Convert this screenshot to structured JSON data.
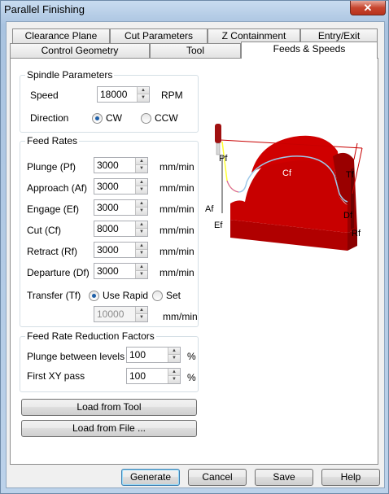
{
  "window": {
    "title": "Parallel Finishing",
    "close_glyph": "✕"
  },
  "tabs": {
    "back_row": [
      "Clearance Plane",
      "Cut Parameters",
      "Z Containment",
      "Entry/Exit"
    ],
    "front_row": [
      "Control Geometry",
      "Tool",
      "Feeds & Speeds"
    ],
    "active": "Feeds & Speeds"
  },
  "spindle": {
    "title": "Spindle Parameters",
    "speed_label": "Speed",
    "speed_value": "18000",
    "speed_unit": "RPM",
    "direction_label": "Direction",
    "cw_label": "CW",
    "ccw_label": "CCW",
    "direction_selected": "CW"
  },
  "feed_rates": {
    "title": "Feed Rates",
    "unit": "mm/min",
    "rows": [
      {
        "label": "Plunge (Pf)",
        "value": "3000"
      },
      {
        "label": "Approach (Af)",
        "value": "3000"
      },
      {
        "label": "Engage (Ef)",
        "value": "3000"
      },
      {
        "label": "Cut (Cf)",
        "value": "8000"
      },
      {
        "label": "Retract (Rf)",
        "value": "3000"
      },
      {
        "label": "Departure  (Df)",
        "value": "3000"
      }
    ],
    "transfer_label": "Transfer (Tf)",
    "use_rapid_label": "Use Rapid",
    "set_label": "Set",
    "transfer_selected": "Use Rapid",
    "transfer_value": "10000",
    "transfer_unit": "mm/min"
  },
  "reduction": {
    "title": "Feed Rate Reduction Factors",
    "plunge_label": "Plunge between levels",
    "plunge_value": "100",
    "first_label": "First XY pass",
    "first_value": "100",
    "unit": "%"
  },
  "load_tool_label": "Load from Tool",
  "load_file_label": "Load from File ...",
  "diagram": {
    "labels": [
      "Pf",
      "Cf",
      "Tf",
      "Af",
      "Ef",
      "Df",
      "Rf"
    ]
  },
  "footer": {
    "generate": "Generate",
    "cancel": "Cancel",
    "save": "Save",
    "help": "Help"
  },
  "colors": {
    "part_red": "#c80000",
    "tool_path_yellow": "#ffff33"
  }
}
